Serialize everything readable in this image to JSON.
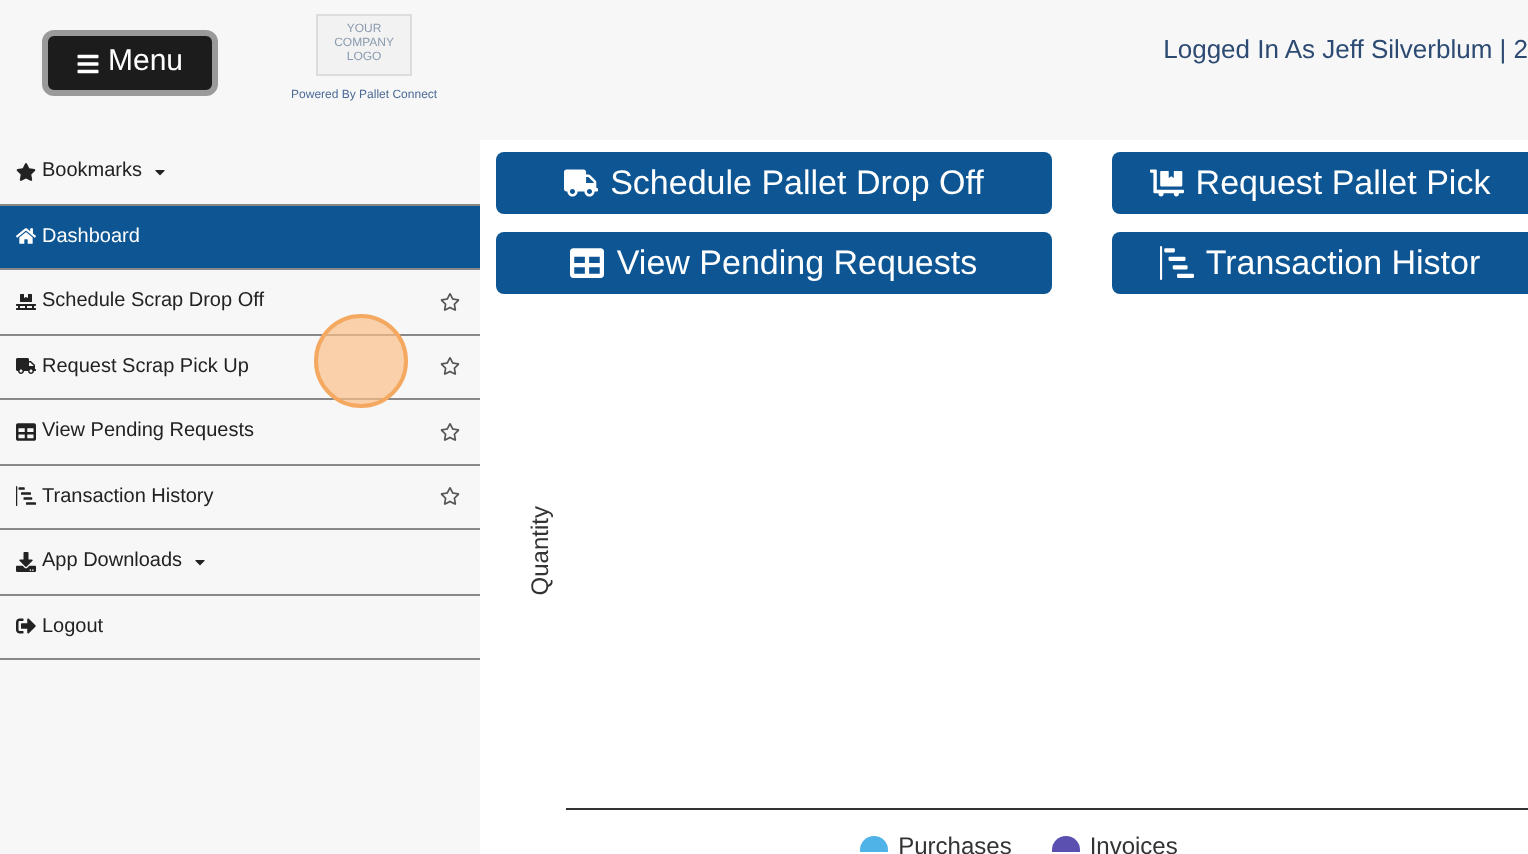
{
  "header": {
    "menu_button": "Menu",
    "logo_lines": [
      "YOUR",
      "COMPANY",
      "LOGO"
    ],
    "powered_by": "Powered By Pallet Connect",
    "user_info": "Logged In As Jeff Silverblum | 2"
  },
  "sidebar": {
    "items": [
      {
        "label": "Bookmarks",
        "kind": "dropdown",
        "selected": false
      },
      {
        "label": "Dashboard",
        "kind": "link",
        "selected": true
      },
      {
        "label": "Schedule Scrap Drop Off",
        "kind": "bookmarkable",
        "selected": false,
        "starred": false
      },
      {
        "label": "Request Scrap Pick Up",
        "kind": "bookmarkable",
        "selected": false,
        "starred": false
      },
      {
        "label": "View Pending Requests",
        "kind": "bookmarkable",
        "selected": false,
        "starred": false
      },
      {
        "label": "Transaction History",
        "kind": "bookmarkable",
        "selected": false,
        "starred": false
      },
      {
        "label": "App Downloads",
        "kind": "dropdown",
        "selected": false
      },
      {
        "label": "Logout",
        "kind": "link",
        "selected": false
      }
    ]
  },
  "actions": [
    "Schedule Pallet Drop Off",
    "Request Pallet Pick",
    "View Pending Requests",
    "Transaction Histor"
  ],
  "chart": {
    "ylabel": "Quantity",
    "legend": [
      {
        "label": "Purchases",
        "color": "#4fb3e8"
      },
      {
        "label": "Invoices",
        "color": "#5b4fb0"
      }
    ]
  }
}
